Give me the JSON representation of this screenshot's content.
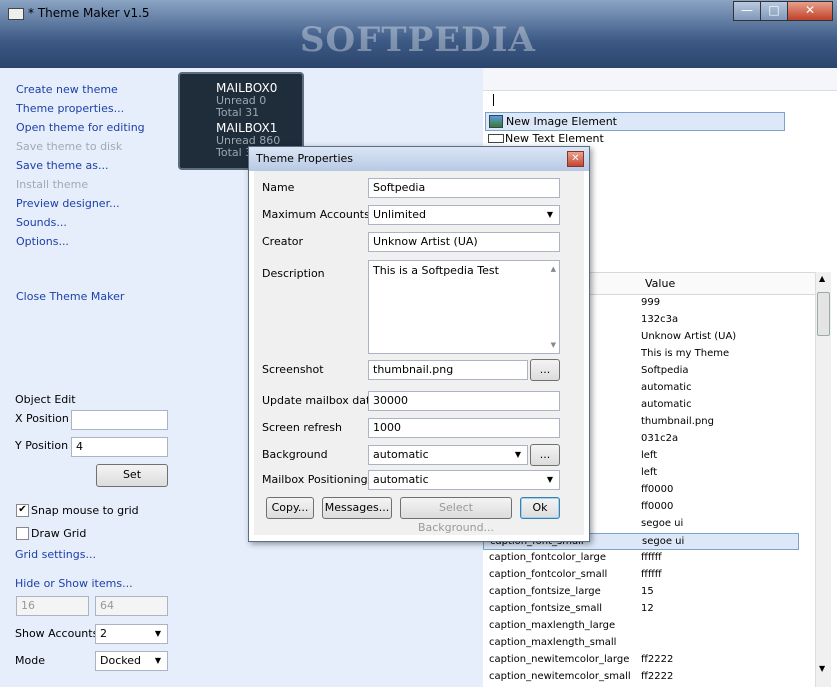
{
  "window": {
    "title": "* Theme Maker v1.5",
    "watermark": "SOFTPEDIA",
    "buttons": [
      "—",
      "□",
      "✕"
    ]
  },
  "sidebar": {
    "links": [
      {
        "label": "Create new theme",
        "enabled": true
      },
      {
        "label": "Theme properties...",
        "enabled": true
      },
      {
        "label": "Open theme for editing",
        "enabled": true
      },
      {
        "label": "Save theme to disk",
        "enabled": false
      },
      {
        "label": "Save theme as...",
        "enabled": true
      },
      {
        "label": "Install theme",
        "enabled": false
      },
      {
        "label": "Preview designer...",
        "enabled": true
      },
      {
        "label": "Sounds...",
        "enabled": true
      },
      {
        "label": "Options...",
        "enabled": true
      }
    ],
    "close_label": "Close Theme Maker",
    "object_edit": {
      "title": "Object Edit",
      "x_label": "X Position",
      "x_value": "",
      "y_label": "Y Position",
      "y_value": "4",
      "set_label": "Set"
    },
    "snap_label": "Snap mouse to grid",
    "snap_checked": true,
    "draw_grid_label": "Draw Grid",
    "draw_grid_checked": false,
    "grid_settings_label": "Grid settings...",
    "hide_show_label": "Hide or Show items...",
    "field_a": "16",
    "field_b": "64",
    "show_accounts_label": "Show Accounts",
    "show_accounts_value": "2",
    "mode_label": "Mode",
    "mode_value": "Docked"
  },
  "preview": {
    "mailbox0": {
      "name": "MAILBOX0",
      "unread": "Unread 0",
      "total": "Total 31"
    },
    "mailbox1": {
      "name": "MAILBOX1",
      "unread": "Unread 860",
      "total": "Total 31"
    }
  },
  "elements": {
    "new_image": "New Image Element",
    "new_text": "New Text Element"
  },
  "properties": {
    "value_header": "Value",
    "rows": [
      {
        "name": "",
        "value": "999"
      },
      {
        "name": "",
        "value": "132c3a"
      },
      {
        "name": "",
        "value": "Unknow Artist (UA)"
      },
      {
        "name": "",
        "value": "This is my Theme"
      },
      {
        "name": "",
        "value": "Softpedia"
      },
      {
        "name": "",
        "value": "automatic"
      },
      {
        "name": "",
        "value": "automatic"
      },
      {
        "name": "",
        "value": "thumbnail.png"
      },
      {
        "name": "",
        "value": "031c2a"
      },
      {
        "name": "",
        "value": "left"
      },
      {
        "name": "",
        "value": "left"
      },
      {
        "name": "arge",
        "value": "ff0000"
      },
      {
        "name": "mall",
        "value": "ff0000"
      },
      {
        "name": "",
        "value": "segoe ui"
      },
      {
        "name": "caption_font_small",
        "value": "segoe ui"
      },
      {
        "name": "caption_fontcolor_large",
        "value": "ffffff"
      },
      {
        "name": "caption_fontcolor_small",
        "value": "ffffff"
      },
      {
        "name": "caption_fontsize_large",
        "value": "15"
      },
      {
        "name": "caption_fontsize_small",
        "value": "12"
      },
      {
        "name": "caption_maxlength_large",
        "value": ""
      },
      {
        "name": "caption_maxlength_small",
        "value": ""
      },
      {
        "name": "caption_newitemcolor_large",
        "value": "ff2222"
      },
      {
        "name": "caption_newitemcolor_small",
        "value": "ff2222"
      }
    ]
  },
  "dialog": {
    "title": "Theme Properties",
    "name_label": "Name",
    "name_value": "Softpedia",
    "max_accounts_label": "Maximum Accounts",
    "max_accounts_value": "Unlimited",
    "creator_label": "Creator",
    "creator_value": "Unknow Artist (UA)",
    "description_label": "Description",
    "description_value": "This is a Softpedia Test",
    "screenshot_label": "Screenshot",
    "screenshot_value": "thumbnail.png",
    "browse_label": "...",
    "update_label": "Update mailbox data",
    "update_value": "30000",
    "refresh_label": "Screen refresh",
    "refresh_value": "1000",
    "background_label": "Background",
    "background_value": "automatic",
    "positioning_label": "Mailbox Positioning",
    "positioning_value": "automatic",
    "copy_label": "Copy...",
    "messages_label": "Messages...",
    "select_bg_label": "Select Background...",
    "ok_label": "Ok"
  }
}
